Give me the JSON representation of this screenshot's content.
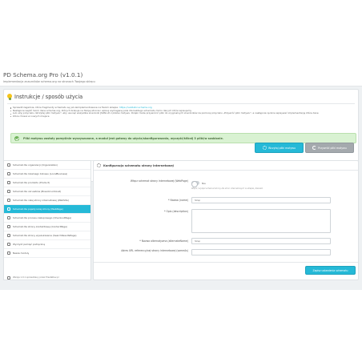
{
  "header": {
    "title": "PD Schema.org Pro (v1.0.1)",
    "subtitle": "Implementacja znaczników schema.org na stronach Twojego sklepu"
  },
  "instructions": {
    "title": "Instrukcje / sposób użycia",
    "items": [
      "Sprawdź zagadnie, które fragmenty schematu są już zaimplementowane na Twoim sklepie:",
      "Następnie wejdź moim dane schema.org, których brakuje na Twojej stronie i wpisuj wymaganą pola dla każdego schematu mimo danych które wpisujemy",
      "Lub użyj przycisku „Wczytaj pliki motywu\", aby usunąć wszystkie znaczniki JSON-LD z plików motywu. Dzięki może przywrócić pliki do oryginalnych znaczników za pomocą przycisku „Przywróć pliki motywu\", a następnie ręcznie wpisywać implementację które dane",
      "które chcesz w nowych miejsce"
    ],
    "link": "https://validator.schema.org",
    "alert": "Pliki motywu zostały pomyślnie wyczyszczone, a moduł jest gotowy do użycia/skonfigurowania, wyczyść/kliknij 3 pliki/w szablonie.",
    "btn_upload": "Wczytaj pliki motywu",
    "btn_restore": "Przywróć pliki motywu"
  },
  "sidebar": {
    "items": [
      {
        "label": "Schemat dla organizacji (Organization)",
        "active": false
      },
      {
        "label": "Schemat dla lokalnego biznesu (LocalBusiness)",
        "active": false
      },
      {
        "label": "Schemat dla produktu (Product)",
        "active": false
      },
      {
        "label": "Schemat dla okruszków (BreadcrumbList)",
        "active": false
      },
      {
        "label": "Schemat dla całej strony internetowej (WebSite)",
        "active": false
      },
      {
        "label": "Schemat dla pojedynczej strony (WebPage)",
        "active": true
      },
      {
        "label": "Schemat dla procesu zakupowego (CheckoutPage)",
        "active": false
      },
      {
        "label": "Schemat dla strony kontaktowej (ContactPage)",
        "active": false
      },
      {
        "label": "Schemat dla strony wyszukiwania (SearchResultsPage)",
        "active": false
      },
      {
        "label": "Wyczyść pamięć podręczną",
        "active": false
      },
      {
        "label": "Nasze moduły",
        "active": false
      }
    ],
    "footer_version": "Wersja 1.0.1 sprawdzany przez PrestaDev.pl"
  },
  "config": {
    "title": "Konfiguracja schematu strony internetowej",
    "fields": {
      "enable_label": "Włącz schemat strony internetowej (WebPage)",
      "enable_value": "Nie",
      "enable_help": "Włącz / wyłącz schemat strony dla stron internetowych w sklepie, dlakażd.",
      "name_label": "* Nazwa (name)",
      "name_value": "Sklep",
      "desc_label": "* Opis (description)",
      "alt_label": "* Nazwa alternatywna (alternateName)",
      "alt_value": "Sklep",
      "url_label": "Adres URL referencyjnej strony internetowej (sameAs)"
    },
    "save_label": "Zapisz ustawienia schematu"
  },
  "colors": {
    "accent": "#25b9d7",
    "success_bg": "#d9f2d2",
    "neutral_button": "#a4a9ad"
  }
}
